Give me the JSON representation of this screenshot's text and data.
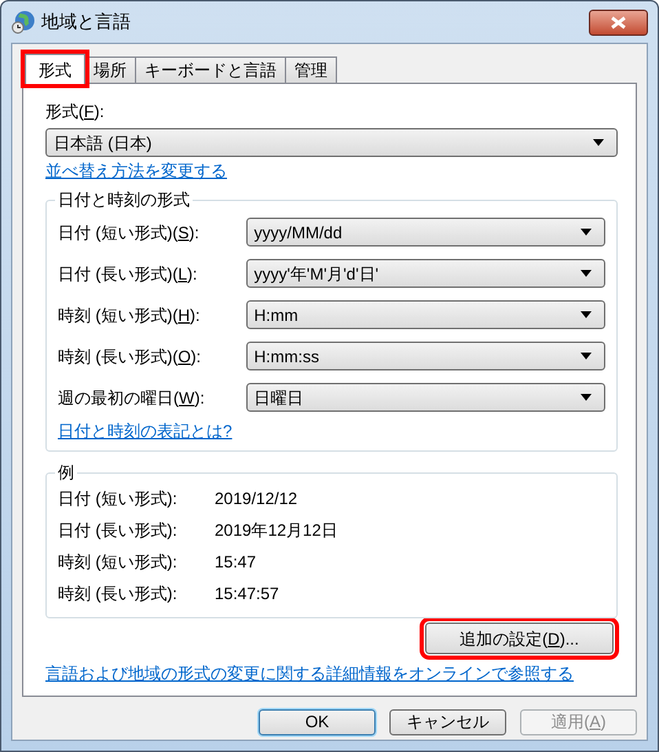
{
  "window": {
    "title": "地域と言語"
  },
  "tabs": [
    {
      "label": "形式",
      "selected": true,
      "highlighted": true
    },
    {
      "label": "場所",
      "selected": false,
      "highlighted": false
    },
    {
      "label": "キーボードと言語",
      "selected": false,
      "highlighted": false
    },
    {
      "label": "管理",
      "selected": false,
      "highlighted": false
    }
  ],
  "format": {
    "label_before": "形式(",
    "access_key": "F",
    "label_after": "):",
    "value": "日本語 (日本)"
  },
  "sort_link": "並べ替え方法を変更する",
  "date_time_group": {
    "title": "日付と時刻の形式",
    "rows": [
      {
        "label_before": "日付 (短い形式)(",
        "access_key": "S",
        "label_after": "):",
        "value": "yyyy/MM/dd"
      },
      {
        "label_before": "日付 (長い形式)(",
        "access_key": "L",
        "label_after": "):",
        "value": "yyyy'年'M'月'd'日'"
      },
      {
        "label_before": "時刻 (短い形式)(",
        "access_key": "H",
        "label_after": "):",
        "value": "H:mm"
      },
      {
        "label_before": "時刻 (長い形式)(",
        "access_key": "O",
        "label_after": "):",
        "value": "H:mm:ss"
      },
      {
        "label_before": "週の最初の曜日(",
        "access_key": "W",
        "label_after": "):",
        "value": "日曜日"
      }
    ],
    "link": "日付と時刻の表記とは?"
  },
  "example_group": {
    "title": "例",
    "rows": [
      {
        "label": "日付 (短い形式):",
        "value": "2019/12/12"
      },
      {
        "label": "日付 (長い形式):",
        "value": "2019年12月12日"
      },
      {
        "label": "時刻 (短い形式):",
        "value": "15:47"
      },
      {
        "label": "時刻 (長い形式):",
        "value": "15:47:57"
      }
    ]
  },
  "additional_button": {
    "label_before": "追加の設定(",
    "access_key": "D",
    "label_after": ")...",
    "highlighted": true
  },
  "online_link": "言語および地域の形式の変更に関する詳細情報をオンラインで参照する",
  "buttons": [
    {
      "label_before": "OK",
      "kind": "default",
      "disabled": false
    },
    {
      "label_before": "キャンセル",
      "kind": "normal",
      "disabled": false
    },
    {
      "label_before": "適用(",
      "access_key": "A",
      "label_after": ")",
      "kind": "normal",
      "disabled": true
    }
  ]
}
